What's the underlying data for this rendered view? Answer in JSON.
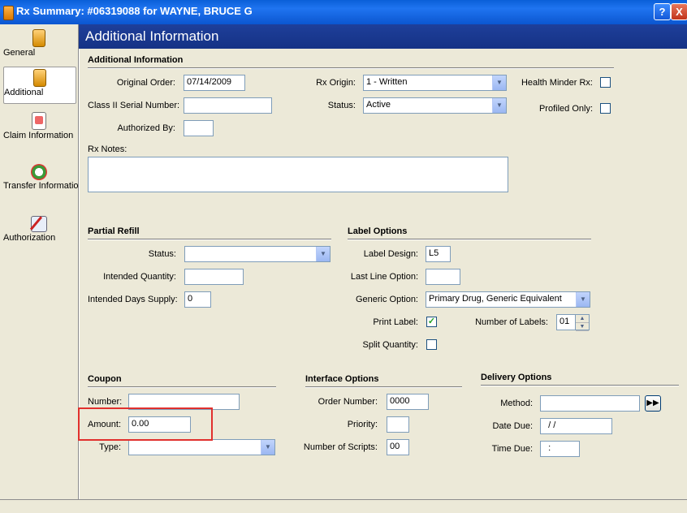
{
  "window": {
    "title": "Rx Summary: #06319088 for WAYNE, BRUCE G",
    "help_label": "?",
    "close_label": "X"
  },
  "sidebar": {
    "items": [
      {
        "label": "General",
        "icon": "pill-bottle-icon"
      },
      {
        "label": "Additional",
        "icon": "pill-bottle-document-icon"
      },
      {
        "label": "Claim Information",
        "icon": "claim-document-icon"
      },
      {
        "label": "Transfer Information",
        "icon": "transfer-arrows-icon"
      },
      {
        "label": "Authorization",
        "icon": "authorization-pen-icon"
      }
    ],
    "active": "Additional"
  },
  "header": {
    "title": "Additional Information"
  },
  "additional_info": {
    "section_title": "Additional Information",
    "original_order_label": "Original Order:",
    "original_order_value": "07/14/2009",
    "class2_label": "Class II Serial Number:",
    "class2_value": "",
    "authorized_by_label": "Authorized By:",
    "authorized_by_value": "",
    "rx_origin_label": "Rx Origin:",
    "rx_origin_value": "1 - Written",
    "status_label": "Status:",
    "status_value": "Active",
    "health_minder_label": "Health Minder Rx:",
    "health_minder_checked": false,
    "profiled_only_label": "Profiled Only:",
    "profiled_only_checked": false,
    "rx_notes_label": "Rx Notes:",
    "rx_notes_value": ""
  },
  "partial_refill": {
    "section_title": "Partial Refill",
    "status_label": "Status:",
    "status_value": "",
    "intended_qty_label": "Intended Quantity:",
    "intended_qty_value": "",
    "intended_days_label": "Intended Days Supply:",
    "intended_days_value": "0"
  },
  "label_options": {
    "section_title": "Label Options",
    "label_design_label": "Label Design:",
    "label_design_value": "L5",
    "last_line_label": "Last Line Option:",
    "last_line_value": "",
    "generic_option_label": "Generic Option:",
    "generic_option_value": "Primary Drug, Generic Equivalent",
    "print_label_label": "Print Label:",
    "print_label_checked": true,
    "number_of_labels_label": "Number of Labels:",
    "number_of_labels_value": "01",
    "split_qty_label": "Split Quantity:",
    "split_qty_checked": false
  },
  "coupon": {
    "section_title": "Coupon",
    "number_label": "Number:",
    "number_value": "",
    "amount_label": "Amount:",
    "amount_value": "0.00",
    "type_label": "Type:",
    "type_value": ""
  },
  "interface_options": {
    "section_title": "Interface Options",
    "order_number_label": "Order Number:",
    "order_number_value": "0000",
    "priority_label": "Priority:",
    "priority_value": "",
    "num_scripts_label": "Number of Scripts:",
    "num_scripts_value": "00"
  },
  "delivery_options": {
    "section_title": "Delivery Options",
    "method_label": "Method:",
    "method_value": "",
    "date_due_label": "Date Due:",
    "date_due_value": "  / /",
    "time_due_label": "Time Due:",
    "time_due_value": "  :",
    "go_label": "▶▶"
  },
  "checkmark": "✓",
  "combo_arrow": "▼",
  "spin_up": "▲",
  "spin_down": "▼",
  "colors": {
    "highlight": "#e1302d",
    "header": "#1e3f9a",
    "titlebar": "#0a5fd8"
  }
}
